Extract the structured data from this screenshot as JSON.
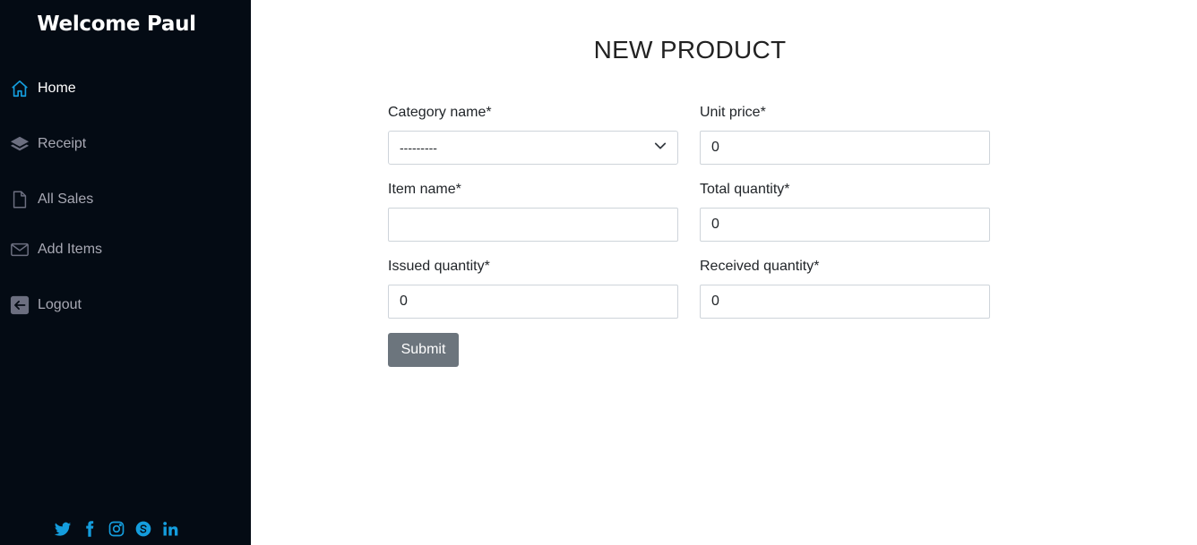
{
  "sidebar": {
    "brand": "Welcome Paul",
    "items": [
      {
        "label": "Home",
        "icon": "home-icon",
        "active": true
      },
      {
        "label": "Receipt",
        "icon": "layers-icon"
      },
      {
        "label": "All Sales",
        "icon": "file-icon"
      },
      {
        "label": "Add Items",
        "icon": "mail-icon"
      },
      {
        "label": "Logout",
        "icon": "arrow-left-square-icon"
      }
    ],
    "socials": [
      "twitter-icon",
      "facebook-icon",
      "instagram-icon",
      "skype-icon",
      "linkedin-icon"
    ]
  },
  "form": {
    "title": "NEW PRODUCT",
    "category": {
      "label": "Category name*",
      "value": "---------"
    },
    "unit_price": {
      "label": "Unit price*",
      "value": "0"
    },
    "item_name": {
      "label": "Item name*",
      "value": ""
    },
    "total_quantity": {
      "label": "Total quantity*",
      "value": "0"
    },
    "issued_quantity": {
      "label": "Issued quantity*",
      "value": "0"
    },
    "received_quantity": {
      "label": "Received quantity*",
      "value": "0"
    },
    "submit_label": "Submit"
  },
  "colors": {
    "sidebar_bg": "#040b14",
    "accent": "#149ddd",
    "muted": "#a8a9b4",
    "button": "#6c757d"
  }
}
